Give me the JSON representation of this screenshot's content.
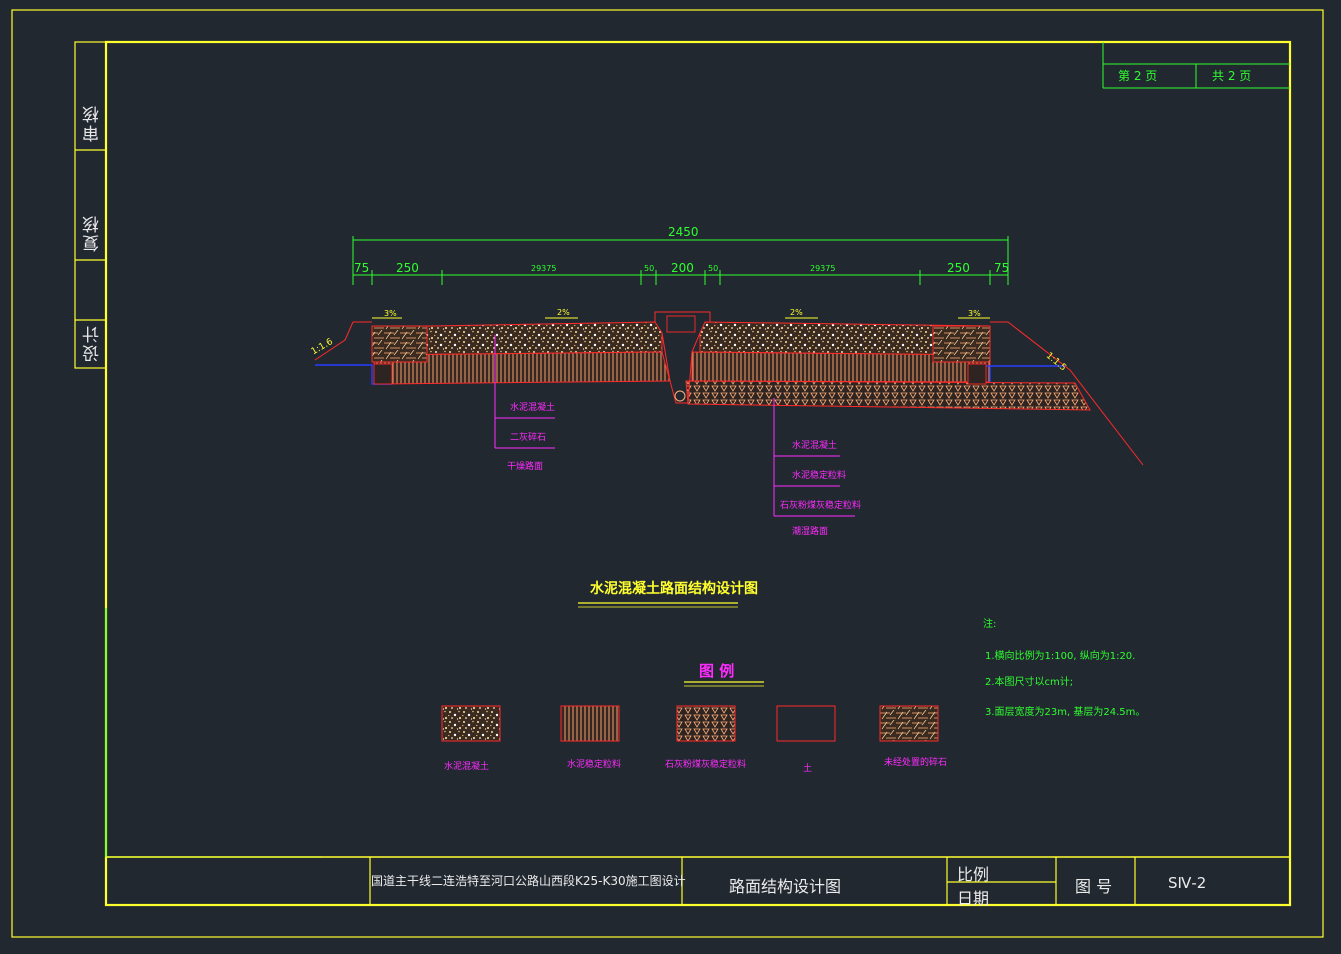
{
  "drawing": {
    "title": "水泥混凝土路面结构设计图",
    "legend_title": "图 例",
    "sheet": {
      "current": "第 2 页",
      "total": "共 2 页"
    },
    "side_labels": [
      "审核",
      "复核",
      "设计"
    ],
    "dimensions": {
      "total": "2450",
      "segments": [
        "75",
        "250",
        "29375",
        "50",
        "200",
        "50",
        "29375",
        "250",
        "75"
      ]
    },
    "slopes": {
      "left_side": "1:1.6",
      "right_side": "1:1.5",
      "crossfall": [
        "3%",
        "2%",
        "2%",
        "3%"
      ]
    },
    "left_callout": {
      "layers": [
        "水泥混凝土",
        "二灰碎石"
      ],
      "caption": "干燥路面"
    },
    "right_callout": {
      "layers": [
        "水泥混凝土",
        "水泥稳定粒料",
        "石灰粉煤灰稳定粒料"
      ],
      "caption": "潮湿路面"
    },
    "legend": [
      {
        "name": "水泥混凝土",
        "pattern": "gravel"
      },
      {
        "name": "水泥稳定粒料",
        "pattern": "vlines"
      },
      {
        "name": "石灰粉煤灰稳定粒料",
        "pattern": "triangles"
      },
      {
        "name": "土",
        "pattern": "empty"
      },
      {
        "name": "未经处置的碎石",
        "pattern": "hatch"
      }
    ],
    "notes": {
      "heading": "注:",
      "items": [
        "1.横向比例为1:100, 纵向为1:20.",
        "2.本图尺寸以cm计;",
        "3.面层宽度为23m, 基层为24.5m。"
      ]
    }
  },
  "title_block": {
    "project": "国道主干线二连浩特至河口公路山西段K25-K30施工图设计",
    "drawing_name": "路面结构设计图",
    "scale_label": "比例",
    "date_label": "日期",
    "number_label": "图 号",
    "number_value": "SⅣ-2"
  },
  "colors": {
    "background": "#212830",
    "frame": "#ffff2e",
    "dimension": "#2fff2f",
    "callout": "#ff2bff",
    "section_outline": "#ff2a2a",
    "pipe": "#2a3cff"
  }
}
